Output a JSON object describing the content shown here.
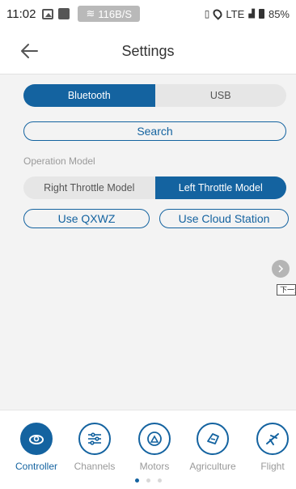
{
  "status_bar": {
    "time": "11:02",
    "network_speed": "116B/S",
    "network_type": "LTE",
    "battery": "85%"
  },
  "header": {
    "title": "Settings"
  },
  "connection": {
    "options": [
      "Bluetooth",
      "USB"
    ],
    "selected": "Bluetooth"
  },
  "search_label": "Search",
  "operation_model": {
    "label": "Operation Model",
    "options": [
      "Right Throttle Model",
      "Left Throttle Model"
    ],
    "selected": "Left Throttle Model"
  },
  "buttons": {
    "qxwz": "Use QXWZ",
    "cloud": "Use Cloud Station"
  },
  "next_tooltip": "下一步",
  "bottom_nav": {
    "items": [
      {
        "label": "Controller",
        "icon": "controller-icon",
        "active": true
      },
      {
        "label": "Channels",
        "icon": "channels-icon",
        "active": false
      },
      {
        "label": "Motors",
        "icon": "motors-icon",
        "active": false
      },
      {
        "label": "Agriculture",
        "icon": "agriculture-icon",
        "active": false
      },
      {
        "label": "Flight",
        "icon": "flight-icon",
        "active": false
      }
    ],
    "page_count": 3,
    "current_page": 1
  },
  "colors": {
    "accent": "#1463a0",
    "background": "#f3f3f3"
  }
}
